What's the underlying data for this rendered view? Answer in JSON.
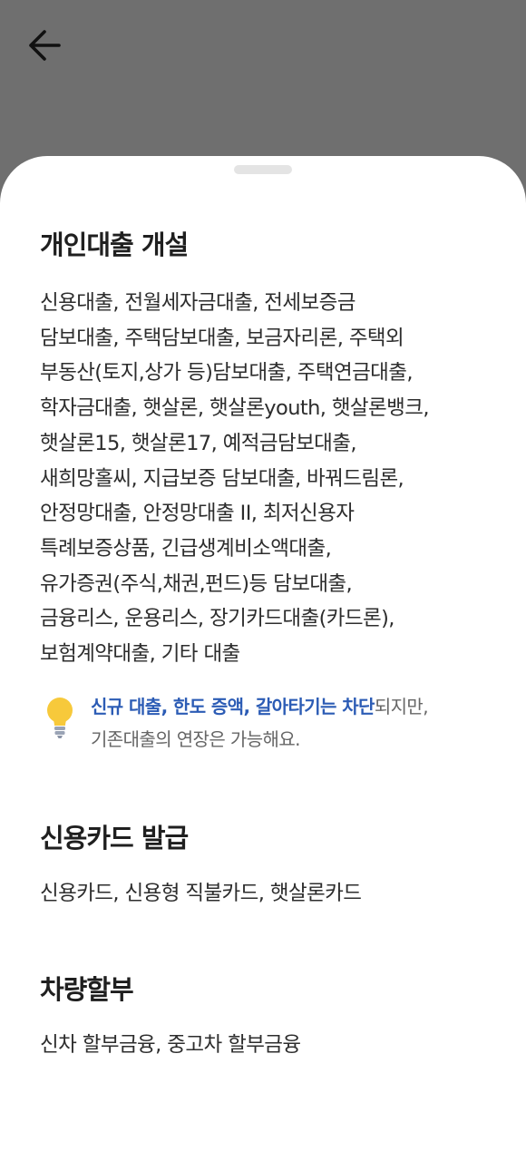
{
  "header": {
    "back_icon": "arrow-left-icon"
  },
  "sections": {
    "personal_loan": {
      "title": "개인대출 개설",
      "lines": [
        "신용대출, 전월세자금대출, 전세보증금",
        "담보대출, 주택담보대출, 보금자리론, 주택외",
        "부동산(토지,상가 등)담보대출, 주택연금대출,",
        "학자금대출, 햇살론, 햇살론youth, 햇살론뱅크,",
        "햇살론15, 햇살론17, 예적금담보대출,",
        "새희망홀씨, 지급보증 담보대출, 바꿔드림론,",
        "안정망대출, 안정망대출 II, 최저신용자",
        "특례보증상품, 긴급생계비소액대출,",
        "유가증권(주식,채권,펀드)등 담보대출,",
        "금융리스, 운용리스, 장기카드대출(카드론),",
        "보험계약대출, 기타 대출"
      ],
      "tip": {
        "icon": "lightbulb-icon",
        "highlight": "신규 대출, 한도 증액, 갈아타기는 차단",
        "rest_line1": "되지만,",
        "line2": "기존대출의 연장은 가능해요."
      }
    },
    "credit_card": {
      "title": "신용카드 발급",
      "body": "신용카드, 신용형 직불카드, 햇살론카드"
    },
    "car_installment": {
      "title": "차량할부",
      "body": "신차 할부금융, 중고차 할부금융"
    }
  },
  "colors": {
    "overlay": "#6f6f6f",
    "sheet": "#ffffff",
    "accent": "#2c5cb5",
    "bulb": "#f7c93b"
  }
}
